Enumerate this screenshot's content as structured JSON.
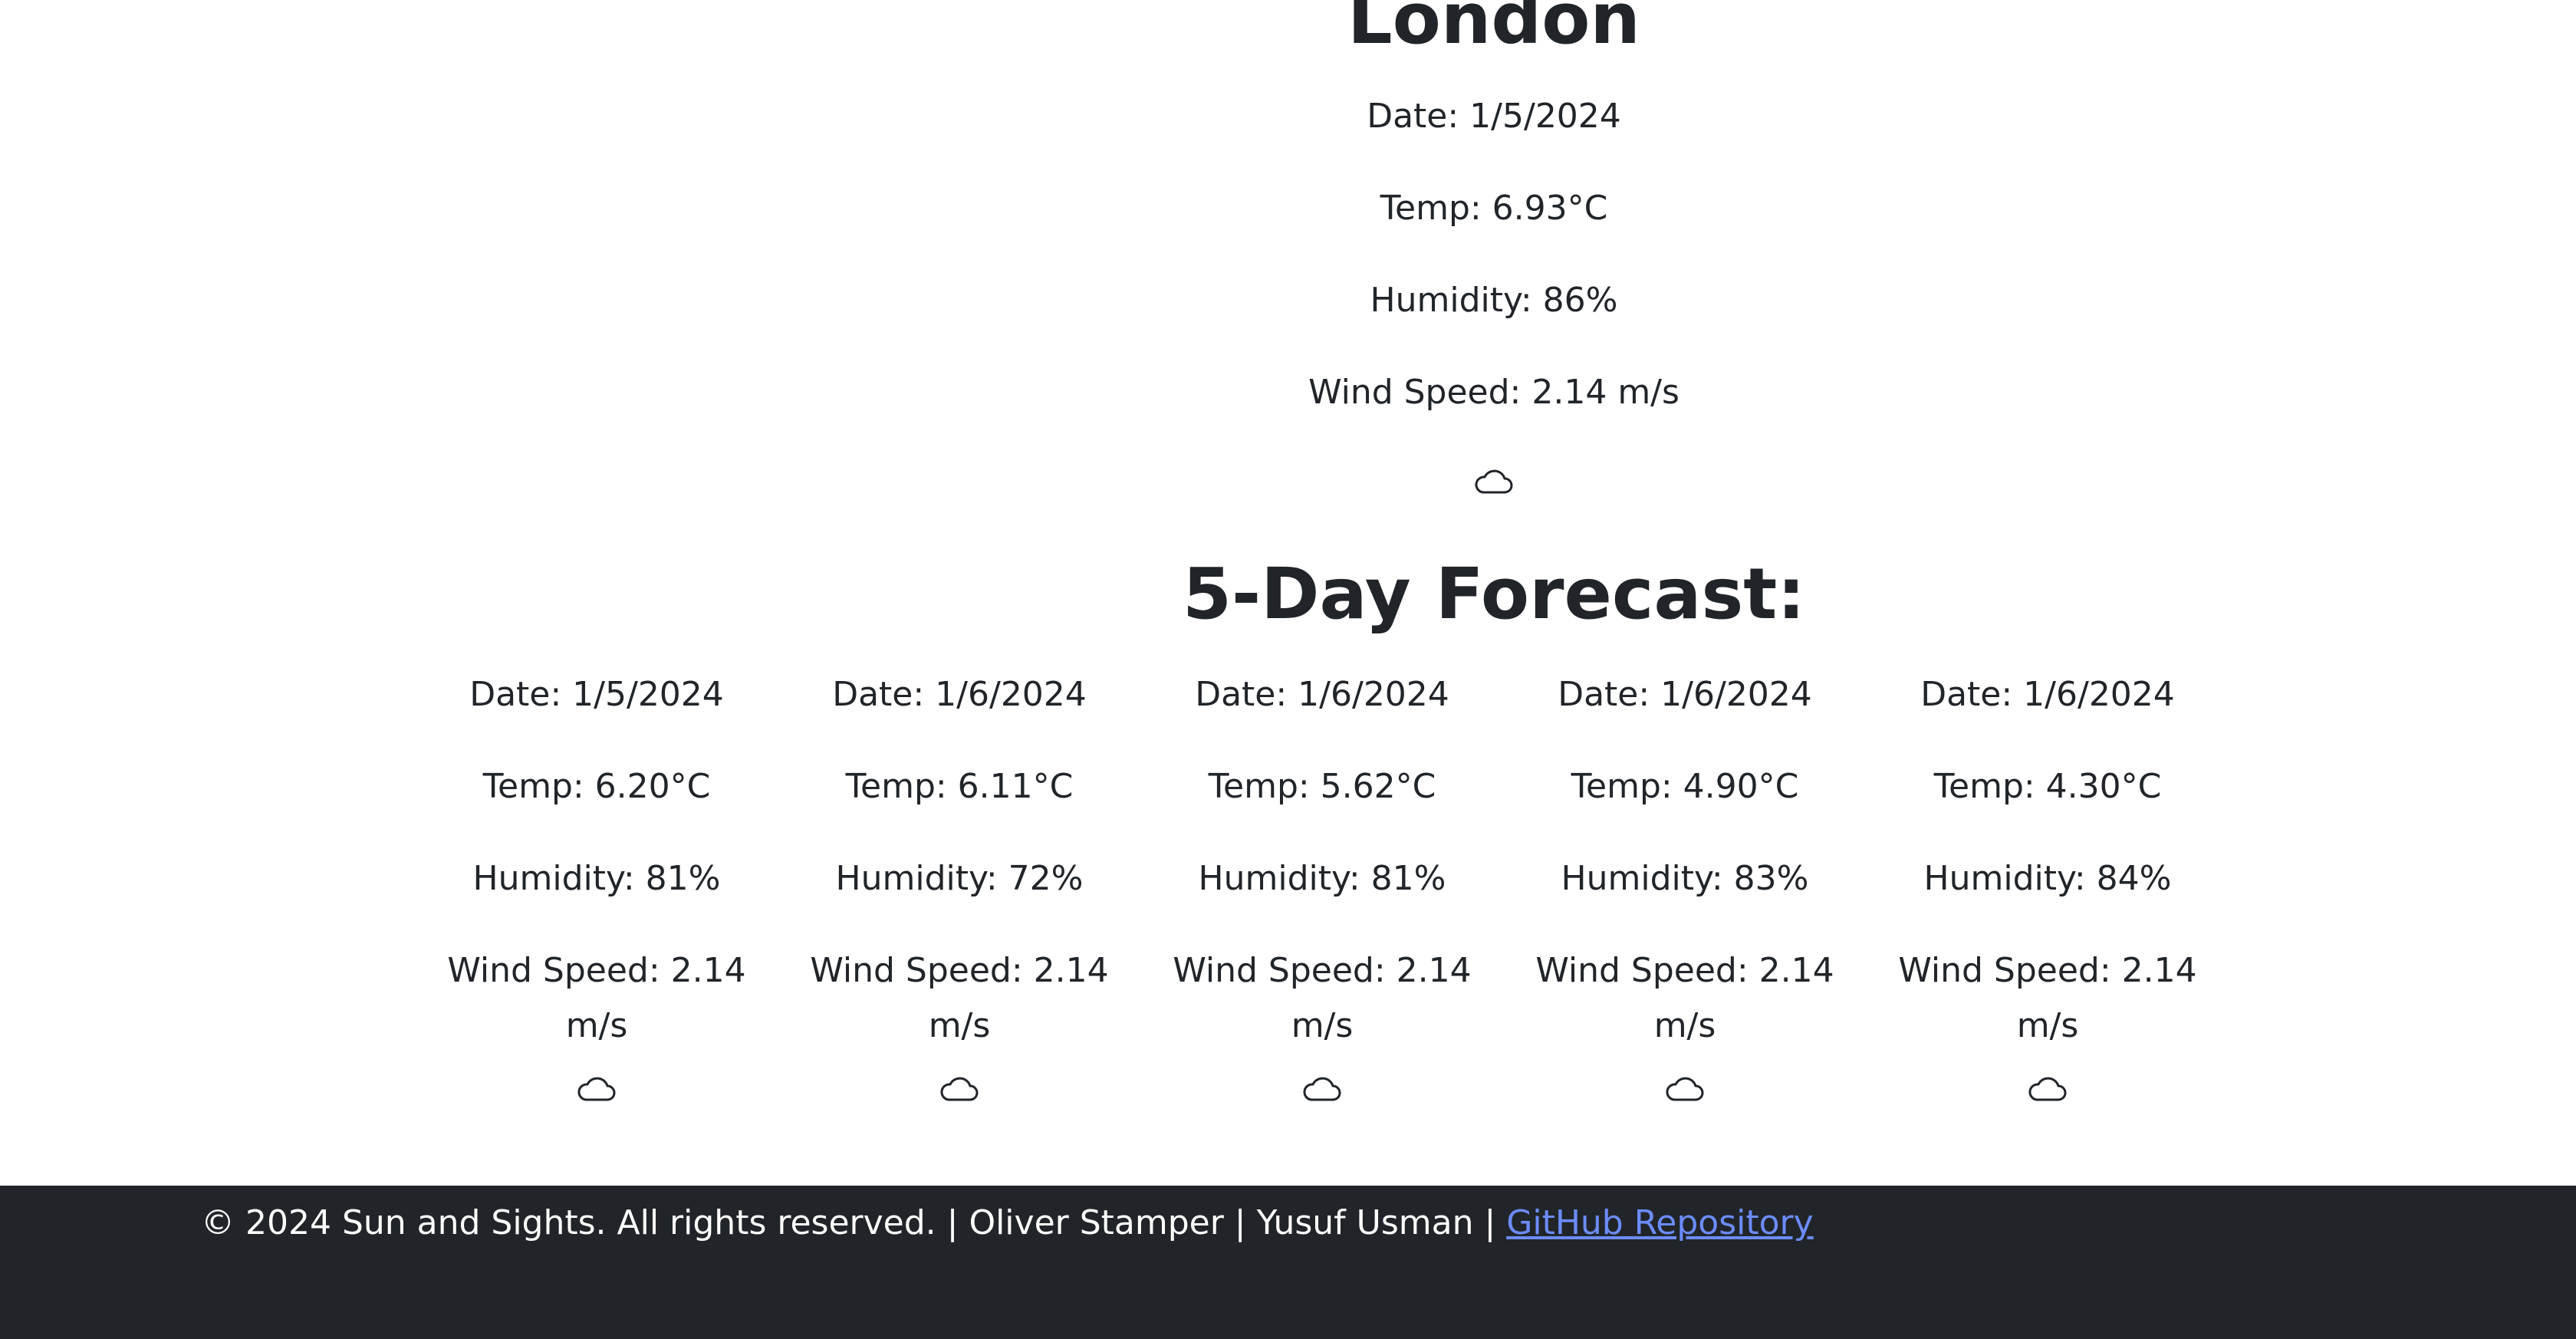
{
  "current": {
    "city": "London",
    "date": "Date: 1/5/2024",
    "temp": "Temp: 6.93°C",
    "humidity": "Humidity: 86%",
    "wind": "Wind Speed: 2.14 m/s",
    "icon": "cloud-icon"
  },
  "forecast": {
    "title": "5-Day Forecast:",
    "days": [
      {
        "date": "Date: 1/5/2024",
        "temp": "Temp: 6.20°C",
        "humidity": "Humidity: 81%",
        "wind": "Wind Speed: 2.14 m/s",
        "icon": "cloud-icon"
      },
      {
        "date": "Date: 1/6/2024",
        "temp": "Temp: 6.11°C",
        "humidity": "Humidity: 72%",
        "wind": "Wind Speed: 2.14 m/s",
        "icon": "cloud-icon"
      },
      {
        "date": "Date: 1/6/2024",
        "temp": "Temp: 5.62°C",
        "humidity": "Humidity: 81%",
        "wind": "Wind Speed: 2.14 m/s",
        "icon": "cloud-icon"
      },
      {
        "date": "Date: 1/6/2024",
        "temp": "Temp: 4.90°C",
        "humidity": "Humidity: 83%",
        "wind": "Wind Speed: 2.14 m/s",
        "icon": "cloud-icon"
      },
      {
        "date": "Date: 1/6/2024",
        "temp": "Temp: 4.30°C",
        "humidity": "Humidity: 84%",
        "wind": "Wind Speed: 2.14 m/s",
        "icon": "cloud-icon"
      }
    ]
  },
  "footer": {
    "text": "© 2024 Sun and Sights. All rights reserved. | Oliver Stamper | Yusuf Usman | ",
    "link_label": "GitHub Repository"
  },
  "colors": {
    "text": "#212529",
    "footer_bg": "#212529",
    "link": "#6c8cff"
  }
}
